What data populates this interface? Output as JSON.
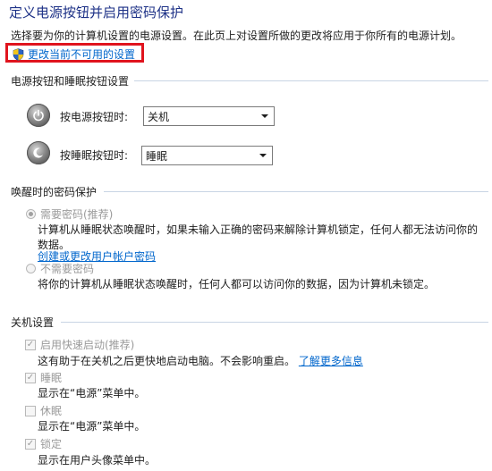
{
  "header": {
    "title": "定义电源按钮并启用密码保护",
    "subtitle": "选择要为你的计算机设置的电源设置。在此页上对设置所做的更改将应用于你所有的电源计划。",
    "change_unavailable_link": "更改当前不可用的设置",
    "shield_icon": "uac-shield-icon"
  },
  "power_buttons_section": {
    "title": "电源按钮和睡眠按钮设置",
    "power_button": {
      "label": "按电源按钮时:",
      "value": "关机"
    },
    "sleep_button": {
      "label": "按睡眠按钮时:",
      "value": "睡眠"
    }
  },
  "wake_password_section": {
    "title": "唤醒时的密码保护",
    "require_password": {
      "label": "需要密码(推荐)",
      "description": "计算机从睡眠状态唤醒时，如果未输入正确的密码来解除计算机锁定，任何人都无法访问你的数",
      "description_line2": "据。",
      "link": "创建或更改用户帐户密码",
      "selected": true
    },
    "no_password": {
      "label": "不需要密码",
      "description": "将你的计算机从睡眠状态唤醒时，任何人都可以访问你的数据，因为计算机未锁定。",
      "selected": false
    }
  },
  "shutdown_section": {
    "title": "关机设置",
    "fast_startup": {
      "label": "启用快速启动(推荐)",
      "description": "这有助于在关机之后更快地启动电脑。不会影响重启。",
      "link": "了解更多信息",
      "checked": true
    },
    "sleep": {
      "label": "睡眠",
      "description": "显示在“电源”菜单中。",
      "checked": true
    },
    "hibernate": {
      "label": "休眠",
      "description": "显示在“电源”菜单中。",
      "checked": false
    },
    "lock": {
      "label": "锁定",
      "description": "显示在用户头像菜单中。",
      "checked": true
    }
  },
  "colors": {
    "title": "#1e3287",
    "link": "#0066cc",
    "highlight_box": "#e0141e",
    "disabled_text": "#9a9a9a",
    "section_line": "#c8d4e4"
  }
}
